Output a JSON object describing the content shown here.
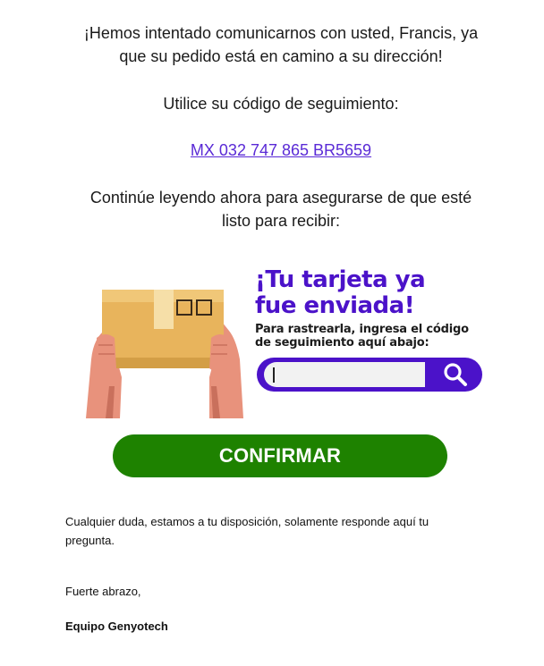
{
  "intro": {
    "line1": "¡Hemos intentado comunicarnos con usted, Francis, ya",
    "line2": "que su pedido está en camino a su dirección!"
  },
  "tracking": {
    "label": "Utilice su código de seguimiento:",
    "code": "MX 032 747 865 BR5659"
  },
  "continue": {
    "line1": "Continúe leyendo ahora para asegurarse de que esté",
    "line2": "listo para recibir:"
  },
  "banner": {
    "headline_line1": "¡Tu tarjeta ya",
    "headline_line2": "fue enviada!",
    "sub_line1": "Para rastrearla, ingresa el código",
    "sub_line2": "de seguimiento aquí abajo:",
    "search_icon": "search-icon",
    "input_value": ""
  },
  "confirm_label": "CONFIRMAR",
  "footer": {
    "questions_line1": "Cualquier duda, estamos a tu disposición, solamente responde aquí tu",
    "questions_line2": "pregunta.",
    "greeting": "Fuerte abrazo,",
    "signature": "Equipo Genyotech"
  },
  "colors": {
    "brand_purple": "#4b12c9",
    "link": "#5a2ad6",
    "confirm_green": "#1e8200"
  }
}
